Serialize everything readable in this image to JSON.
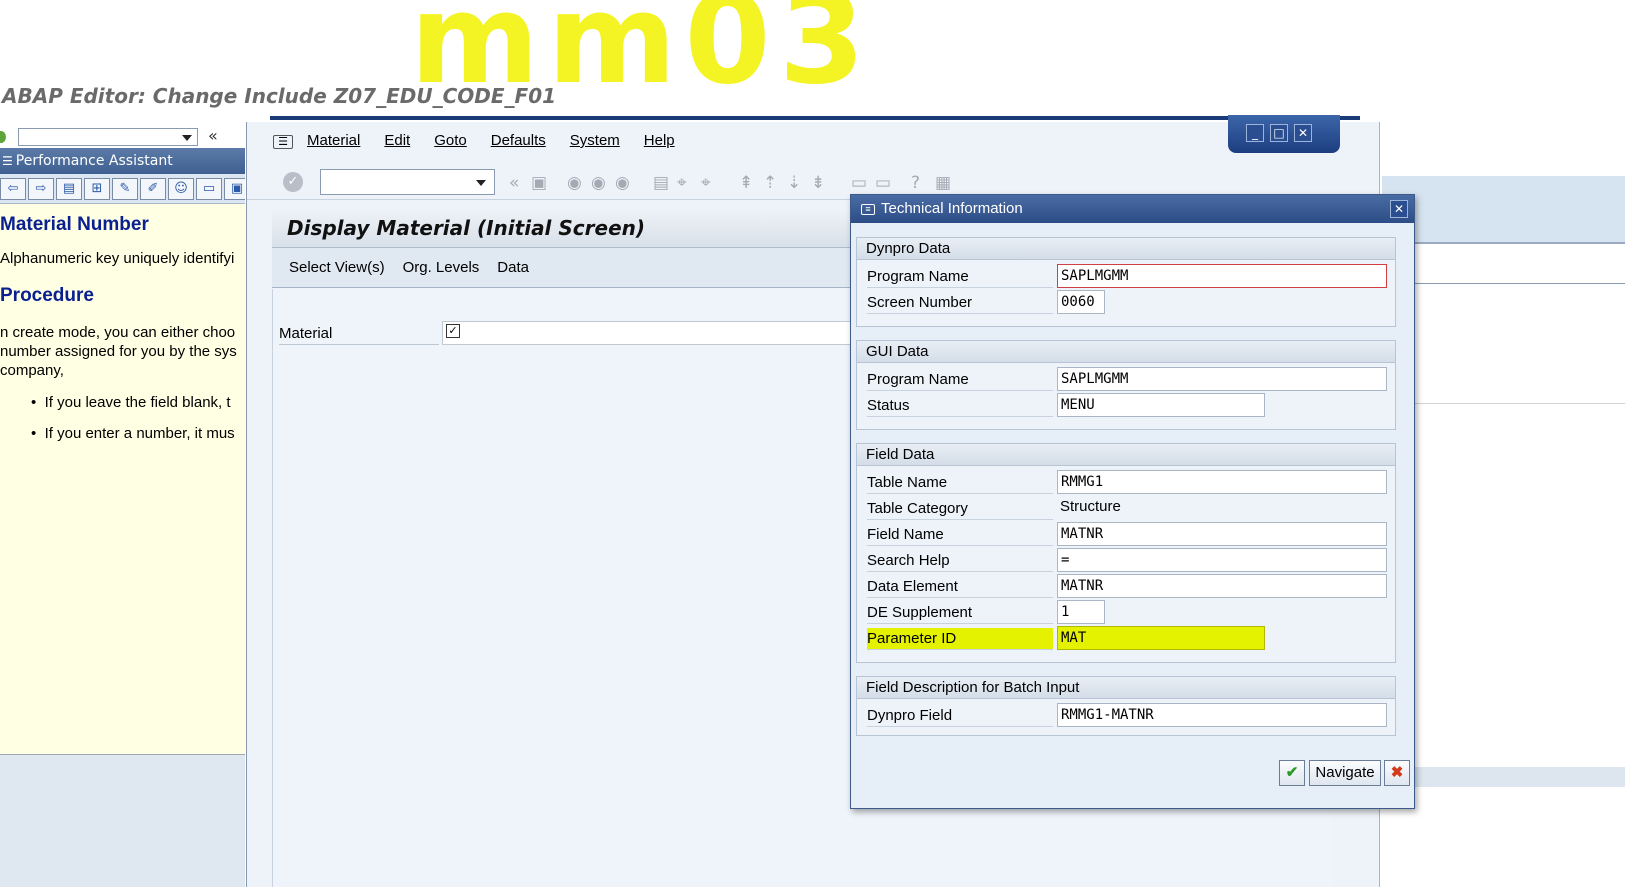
{
  "bg_editor": {
    "title": "ABAP Editor: Change Include Z07_EDU_CODE_F01"
  },
  "performance_assistant": {
    "title": "Performance Assistant",
    "heading": "Material Number",
    "description": "Alphanumeric key uniquely identifyi",
    "procedure_heading": "Procedure",
    "body_lines": [
      "n create mode, you can either choo",
      "number assigned for you by the sys",
      "company,"
    ],
    "bullets": [
      "If you leave the field blank, t",
      "If you enter a number, it mus"
    ]
  },
  "main_window": {
    "menu": [
      "Material",
      "Edit",
      "Goto",
      "Defaults",
      "System",
      "Help"
    ],
    "screen_title": "Display Material (Initial Screen)",
    "app_toolbar": [
      "Select View(s)",
      "Org. Levels",
      "Data"
    ],
    "material_label": "Material"
  },
  "dialog": {
    "title": "Technical Information",
    "groups": [
      {
        "header": "Dynpro Data",
        "rows": [
          {
            "label": "Program Name",
            "value": "SAPLMGMM"
          },
          {
            "label": "Screen Number",
            "value": "0060"
          }
        ]
      },
      {
        "header": "GUI Data",
        "rows": [
          {
            "label": "Program Name",
            "value": "SAPLMGMM"
          },
          {
            "label": "Status",
            "value": "MENU"
          }
        ]
      },
      {
        "header": "Field Data",
        "rows": [
          {
            "label": "Table Name",
            "value": "RMMG1"
          },
          {
            "label": "Table Category",
            "value": "Structure"
          },
          {
            "label": "Field Name",
            "value": "MATNR"
          },
          {
            "label": "Search Help",
            "value": "="
          },
          {
            "label": "Data Element",
            "value": "MATNR"
          },
          {
            "label": "DE Supplement",
            "value": "1"
          },
          {
            "label": "Parameter ID",
            "value": "MAT"
          }
        ]
      },
      {
        "header": "Field Description for Batch Input",
        "rows": [
          {
            "label": "Dynpro Field",
            "value": "RMMG1-MATNR"
          }
        ]
      }
    ],
    "navigate_label": "Navigate",
    "highlight_color": "#e4f200"
  },
  "annotation": {
    "handwritten_text": "mm03",
    "color": "#f4f41a"
  }
}
